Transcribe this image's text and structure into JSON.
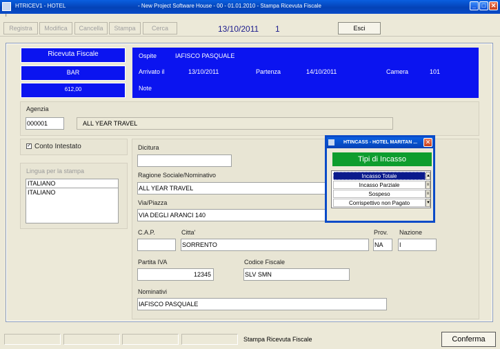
{
  "window": {
    "app_title": "HTRICEV1 - HOTEL",
    "title": "- New Project Software House - 00 - 01.01.2010 - Stampa Ricevuta Fiscale",
    "minimize": "_",
    "maximize": "□",
    "close": "✕"
  },
  "menu": {
    "item": "i"
  },
  "toolbar": {
    "registra": "Registra",
    "modifica": "Modifica",
    "cancella": "Cancella",
    "stampa": "Stampa",
    "cerca": "Cerca",
    "date": "13/10/2011",
    "number": "1",
    "esci": "Esci"
  },
  "receipt": {
    "title": "Ricevuta Fiscale",
    "category": "BAR",
    "amount": "612,00"
  },
  "guest": {
    "ospite_label": "Ospite",
    "ospite_value": "IAFISCO PASQUALE",
    "arrivo_label": "Arrivato il",
    "arrivo_value": "13/10/2011",
    "partenza_label": "Partenza",
    "partenza_value": "14/10/2011",
    "camera_label": "Camera",
    "camera_value": "101",
    "note_label": "Note"
  },
  "agency": {
    "label": "Agenzia",
    "code": "000001",
    "name": "ALL YEAR TRAVEL"
  },
  "conto": {
    "checkbox": "✓",
    "label": "Conto Intestato"
  },
  "lingua": {
    "label": "Lingua per la stampa",
    "selected": "ITALIANO",
    "options": [
      "ITALIANO"
    ]
  },
  "form": {
    "dicitura_label": "Dicitura",
    "dicitura_value": "",
    "ragione_label": "Ragione Sociale/Nominativo",
    "ragione_value": "ALL YEAR TRAVEL",
    "via_label": "Via/Piazza",
    "via_value": "VIA DEGLI ARANCI 140",
    "cap_label": "C.A.P.",
    "cap_value": "",
    "citta_label": "Citta'",
    "citta_value": "SORRENTO",
    "prov_label": "Prov.",
    "prov_value": "NA",
    "nazione_label": "Nazione",
    "nazione_value": "I",
    "piva_label": "Partita IVA",
    "piva_value": "12345",
    "cf_label": "Codice Fiscale",
    "cf_value": "SLV SMN",
    "nominativi_label": "Nominativi",
    "nominativi_value": "IAFISCO PASQUALE"
  },
  "popup": {
    "title": "HTINCASS - HOTEL MARITAN ...",
    "close": "✕",
    "header": "Tipi di Incasso",
    "options": [
      "Incasso Totale",
      "Incasso Parziale",
      "Sospeso",
      "Corrispettivo non Pagato"
    ],
    "selected_index": 0
  },
  "status": {
    "text": "Stampa Ricevuta Fiscale",
    "confirm": "Conferma"
  },
  "colors": {
    "blue_panel": "#0b14f0",
    "titlebar": "#0442b6",
    "green_header": "#0e9d2e",
    "selection": "#0a1a8c"
  }
}
